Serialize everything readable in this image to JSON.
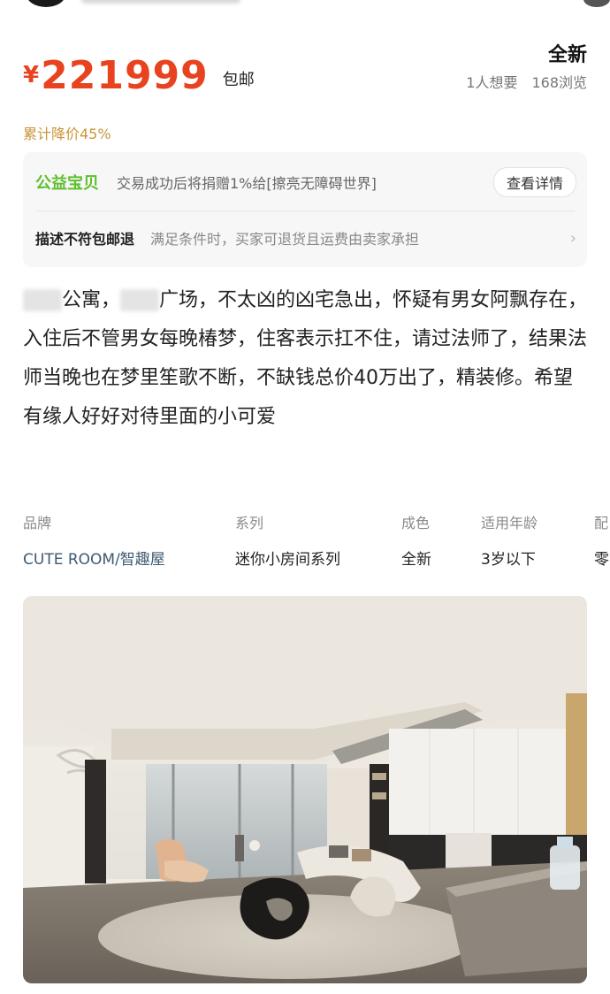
{
  "price": {
    "symbol": "¥",
    "value": "221999",
    "shipping": "包邮"
  },
  "condition": "全新",
  "stats": {
    "wants": "1人想要",
    "views": "168浏览"
  },
  "price_drop": "累计降价45%",
  "charity": {
    "badge": "公益宝贝",
    "text": "交易成功后将捐赠1%给[擦亮无障碍世界]",
    "button": "查看详情"
  },
  "return_policy": {
    "title": "描述不符包邮退",
    "text": "满足条件时，买家可退货且运费由卖家承担"
  },
  "description": {
    "line1_tail": "公寓，",
    "line1_mid": "广场，不太凶的凶宅急出，怀疑有男女",
    "rest": "阿飘存在，入住后不管男女每晚椿梦，住客表示扛不住，请过法师了，结果法师当晚也在梦里笙歌不断，不缺钱总价40万出了，精装修。希望有缘人好好对待里面的小可爱"
  },
  "attributes": [
    {
      "label": "品牌",
      "value": "CUTE ROOM/智趣屋"
    },
    {
      "label": "系列",
      "value": "迷你小房间系列"
    },
    {
      "label": "成色",
      "value": "全新"
    },
    {
      "label": "适用年龄",
      "value": "3岁以下"
    },
    {
      "label": "配",
      "value": "零"
    }
  ],
  "colors": {
    "price": "#e8421f",
    "charity": "#5fbf2e",
    "drop": "#c9963a"
  },
  "icons": {
    "chevron": "chevron-right-icon"
  }
}
